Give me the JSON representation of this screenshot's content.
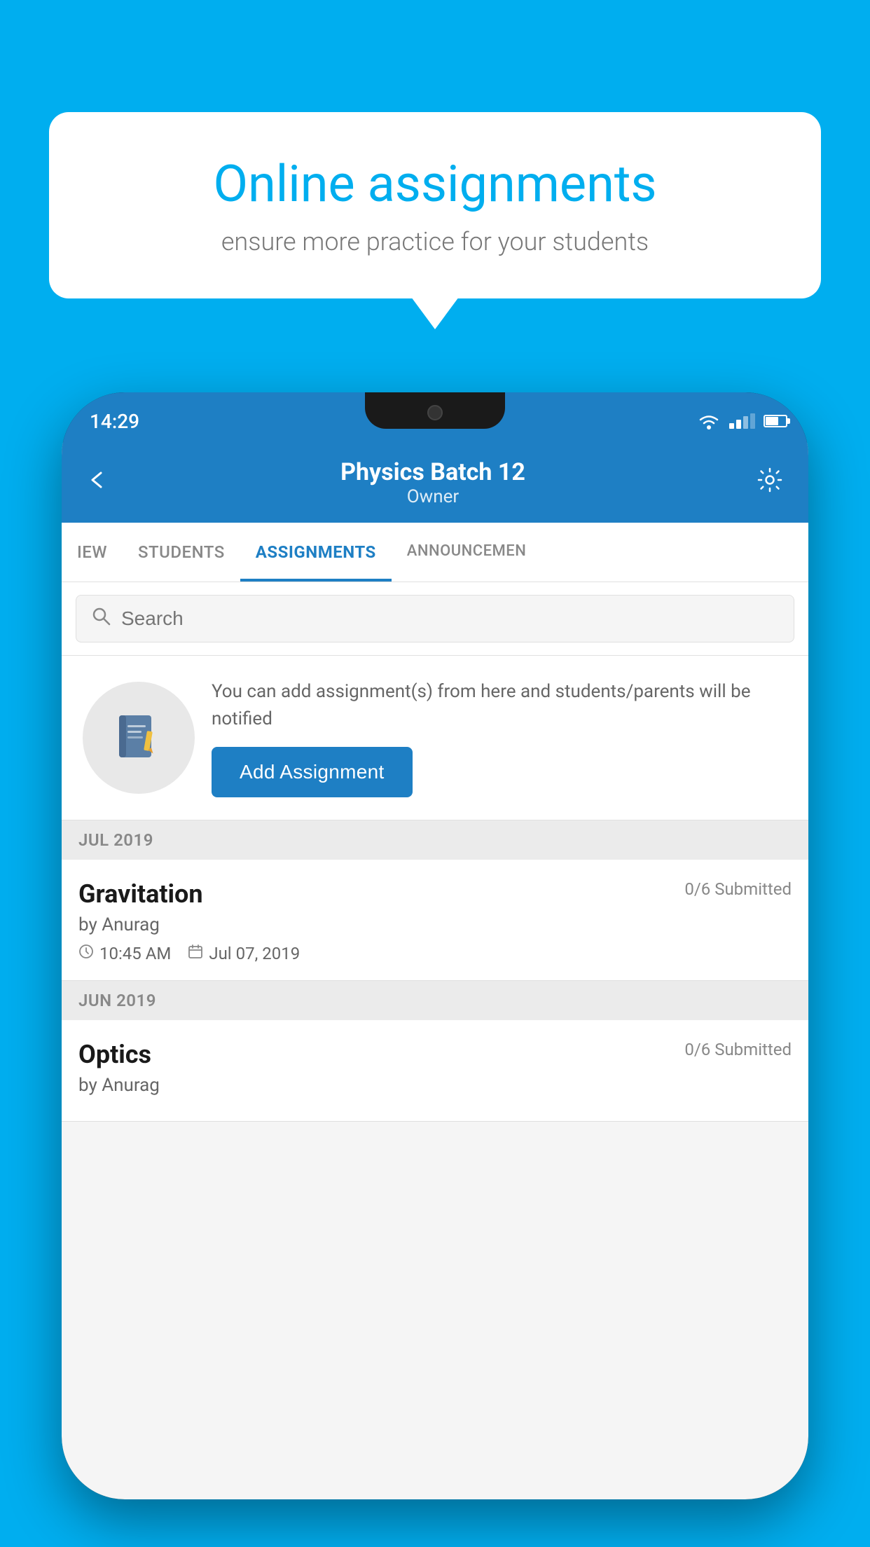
{
  "background_color": "#00AEEF",
  "speech_bubble": {
    "title": "Online assignments",
    "subtitle": "ensure more practice for your students"
  },
  "status_bar": {
    "time": "14:29"
  },
  "header": {
    "title": "Physics Batch 12",
    "subtitle": "Owner",
    "back_label": "←",
    "settings_label": "⚙"
  },
  "tabs": [
    {
      "label": "IEW",
      "active": false
    },
    {
      "label": "STUDENTS",
      "active": false
    },
    {
      "label": "ASSIGNMENTS",
      "active": true
    },
    {
      "label": "ANNOUNCEMEN",
      "active": false
    }
  ],
  "search": {
    "placeholder": "Search"
  },
  "add_assignment": {
    "description": "You can add assignment(s) from here and students/parents will be notified",
    "button_label": "Add Assignment"
  },
  "month_sections": [
    {
      "label": "JUL 2019",
      "assignments": [
        {
          "name": "Gravitation",
          "submitted": "0/6 Submitted",
          "by": "by Anurag",
          "time": "10:45 AM",
          "date": "Jul 07, 2019"
        }
      ]
    },
    {
      "label": "JUN 2019",
      "assignments": [
        {
          "name": "Optics",
          "submitted": "0/6 Submitted",
          "by": "by Anurag",
          "time": "",
          "date": ""
        }
      ]
    }
  ]
}
